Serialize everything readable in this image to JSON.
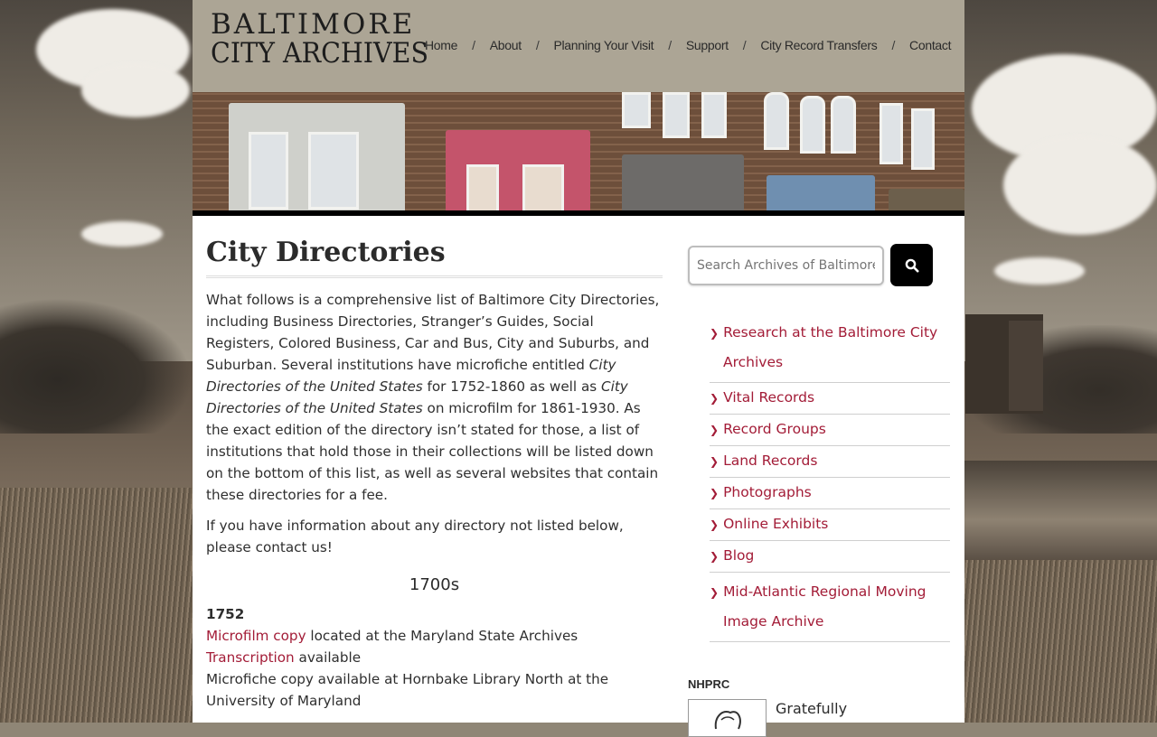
{
  "site": {
    "title_line1": "BALTIMORE",
    "title_line2": "CITY ARCHIVES"
  },
  "nav": {
    "items": [
      "Home",
      "About",
      "Planning Your Visit",
      "Support",
      "City Record Transfers",
      "Contact"
    ],
    "separator": "/"
  },
  "page": {
    "title": "City Directories",
    "intro": {
      "part1": "What follows is a comprehensive list of Baltimore City Directories, including Business Directories, Stranger’s Guides, Social Registers, Colored Business, Car and Bus, City and Suburbs, and Suburban.  Several institutions have microfiche entitled ",
      "em1": "City Directories of the United States",
      "part2": " for 1752-1860 as well as ",
      "em2": "City Directories of the United States",
      "part3": " on microfilm for 1861-1930.  As the exact edition of the directory isn’t stated for those, a list of institutions that hold those in their collections will be listed down on the bottom of this list, as well as several websites that contain these directories for a fee."
    },
    "contact_note": "If you have information about any directory not listed below, please contact us!",
    "decade": "1700s",
    "year": "1752",
    "entries": {
      "microfilm_link": "Microfilm copy",
      "microfilm_rest": " located at the Maryland State Archives",
      "transcription_link": "Transcription",
      "transcription_rest": " available",
      "microfiche": "Microfiche copy available at Hornbake Library North at the University of Maryland"
    }
  },
  "sidebar": {
    "search_placeholder": "Search Archives of Baltimore",
    "search_icon": "search-icon",
    "menu": [
      {
        "line1": "Research at the Baltimore City",
        "line2": "Archives"
      },
      {
        "line1": "Vital Records"
      },
      {
        "line1": "Record Groups"
      },
      {
        "line1": "Land Records"
      },
      {
        "line1": "Photographs"
      },
      {
        "line1": "Online Exhibits"
      },
      {
        "line1": "Blog"
      },
      {
        "line1": "Mid-Atlantic Regional Moving",
        "line2": "Image Archive"
      }
    ],
    "nhprc_label": "NHPRC",
    "gratefully": "Gratefully"
  },
  "colors": {
    "accent": "#a31c37",
    "header": "#aca595",
    "search_button": "#000000"
  }
}
